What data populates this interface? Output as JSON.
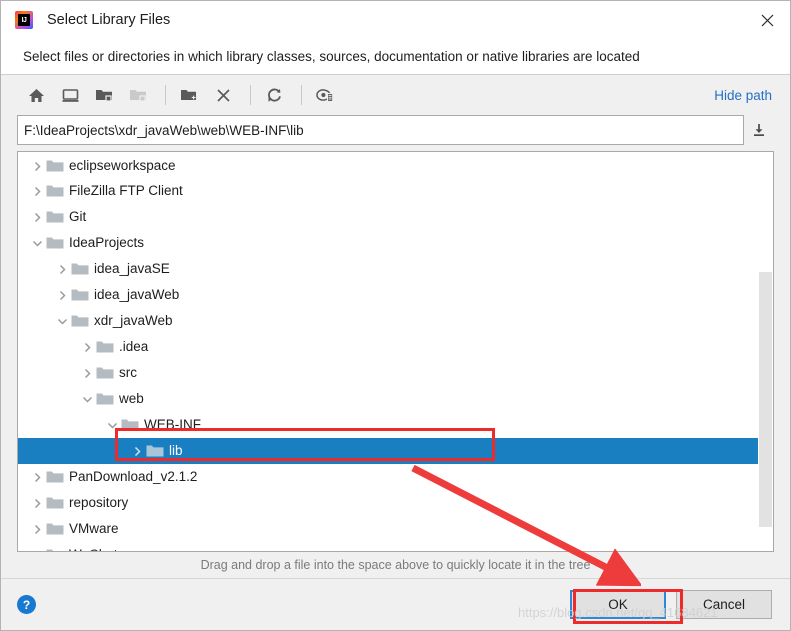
{
  "window": {
    "title": "Select Library Files",
    "app_icon": "intellij-idea-logo",
    "close_label": "✕",
    "subtitle": "Select files or directories in which library classes, sources, documentation or native libraries are located"
  },
  "toolbar": {
    "buttons": [
      {
        "name": "home-icon",
        "tooltip": "Home",
        "enabled": true
      },
      {
        "name": "desktop-icon",
        "tooltip": "Desktop",
        "enabled": true
      },
      {
        "name": "project-folder-icon",
        "tooltip": "Project Directory",
        "enabled": true
      },
      {
        "name": "module-folder-icon",
        "tooltip": "Module Directory",
        "enabled": false
      },
      {
        "name": "new-folder-icon",
        "tooltip": "New Folder",
        "enabled": true
      },
      {
        "name": "delete-icon",
        "tooltip": "Delete",
        "enabled": true
      },
      {
        "name": "refresh-icon",
        "tooltip": "Refresh",
        "enabled": true
      },
      {
        "name": "show-hidden-files-icon",
        "tooltip": "Show Hidden Files",
        "enabled": true
      }
    ],
    "hide_path_label": "Hide path"
  },
  "path": {
    "value": "F:\\IdeaProjects\\xdr_javaWeb\\web\\WEB-INF\\lib",
    "placeholder": "",
    "dropdown_icon": "insert-path-icon"
  },
  "tree": {
    "rows": [
      {
        "label": "eclipseworkspace",
        "depth": 1,
        "state": "collapsed",
        "selected": false,
        "partial_top": true
      },
      {
        "label": "FileZilla FTP Client",
        "depth": 1,
        "state": "collapsed",
        "selected": false
      },
      {
        "label": "Git",
        "depth": 1,
        "state": "collapsed",
        "selected": false
      },
      {
        "label": "IdeaProjects",
        "depth": 1,
        "state": "expanded",
        "selected": false
      },
      {
        "label": "idea_javaSE",
        "depth": 2,
        "state": "collapsed",
        "selected": false
      },
      {
        "label": "idea_javaWeb",
        "depth": 2,
        "state": "collapsed",
        "selected": false
      },
      {
        "label": "xdr_javaWeb",
        "depth": 2,
        "state": "expanded",
        "selected": false
      },
      {
        "label": ".idea",
        "depth": 3,
        "state": "collapsed",
        "selected": false
      },
      {
        "label": "src",
        "depth": 3,
        "state": "collapsed",
        "selected": false
      },
      {
        "label": "web",
        "depth": 3,
        "state": "expanded",
        "selected": false
      },
      {
        "label": "WEB-INF",
        "depth": 4,
        "state": "expanded",
        "selected": false
      },
      {
        "label": "lib",
        "depth": 5,
        "state": "collapsed",
        "selected": true
      },
      {
        "label": "PanDownload_v2.1.2",
        "depth": 1,
        "state": "collapsed",
        "selected": false
      },
      {
        "label": "repository",
        "depth": 1,
        "state": "collapsed",
        "selected": false
      },
      {
        "label": "VMware",
        "depth": 1,
        "state": "collapsed",
        "selected": false
      },
      {
        "label": "WeChat",
        "depth": 1,
        "state": "collapsed",
        "selected": false
      }
    ],
    "scrollbar": {
      "thumb_top_pct": 30,
      "thumb_height_pct": 64
    }
  },
  "hint": {
    "text": "Drag and drop a file into the space above to quickly locate it in the tree"
  },
  "footer": {
    "help_label": "?",
    "ok_label": "OK",
    "cancel_label": "Cancel"
  },
  "annotations": {
    "watermark": "https://blog.csdn.net/qq_41684621",
    "box_color": "#ee2b2b",
    "arrow_color": "#ee3b3b"
  },
  "colors": {
    "selection_blue": "#1a7fc1",
    "link_blue": "#2470c6",
    "annotation_red": "#ee2b2b",
    "dialog_bg": "#f0f0f0"
  }
}
